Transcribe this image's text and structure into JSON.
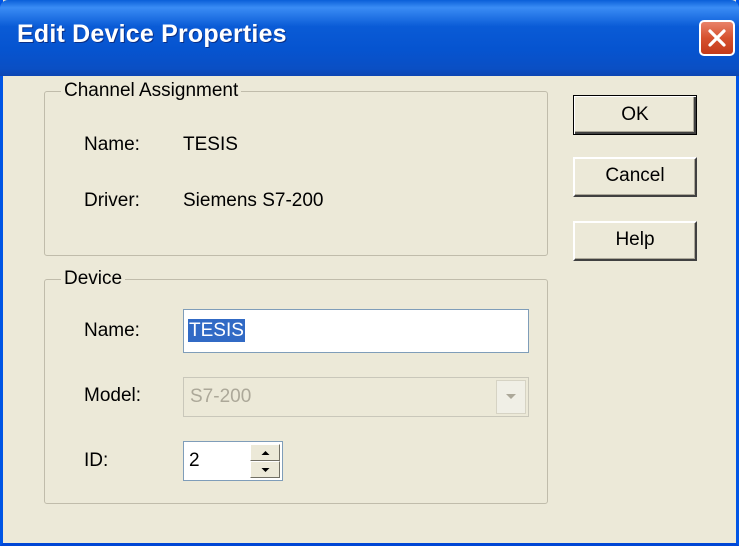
{
  "window": {
    "title": "Edit Device Properties"
  },
  "channel_assignment": {
    "legend": "Channel Assignment",
    "name_label": "Name:",
    "name_value": "TESIS",
    "driver_label": "Driver:",
    "driver_value": "Siemens S7-200"
  },
  "device": {
    "legend": "Device",
    "name_label": "Name:",
    "name_value": "TESIS",
    "model_label": "Model:",
    "model_value": "S7-200",
    "id_label": "ID:",
    "id_value": "2"
  },
  "buttons": {
    "ok": "OK",
    "cancel": "Cancel",
    "help": "Help"
  },
  "icons": {
    "close": "close-icon",
    "dropdown": "chevron-down-icon",
    "spin_up": "arrow-up-icon",
    "spin_down": "arrow-down-icon"
  },
  "colors": {
    "title_bar": "#0a5bd6",
    "dialog_bg": "#ece9d8",
    "selection": "#316ac5",
    "close_button": "#d6512f"
  }
}
